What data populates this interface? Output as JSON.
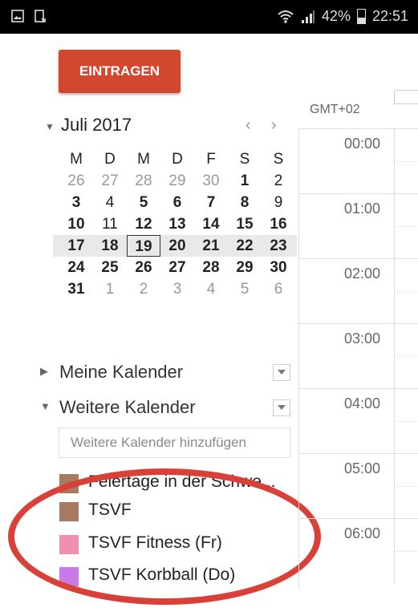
{
  "status_bar": {
    "battery": "42%",
    "battery_level": 0.42,
    "time": "22:51"
  },
  "create_button": "EINTRAGEN",
  "timezone": "GMT+02",
  "mini_calendar": {
    "title": "Juli 2017",
    "prev": "‹",
    "next": "›",
    "weekdays": [
      "M",
      "D",
      "M",
      "D",
      "F",
      "S",
      "S"
    ],
    "weeks": [
      [
        {
          "d": "26",
          "o": true
        },
        {
          "d": "27",
          "o": true
        },
        {
          "d": "28",
          "o": true
        },
        {
          "d": "29",
          "o": true
        },
        {
          "d": "30",
          "o": true
        },
        {
          "d": "1",
          "b": true
        },
        {
          "d": "2"
        }
      ],
      [
        {
          "d": "3",
          "b": true
        },
        {
          "d": "4"
        },
        {
          "d": "5",
          "b": true
        },
        {
          "d": "6",
          "b": true
        },
        {
          "d": "7",
          "b": true
        },
        {
          "d": "8",
          "b": true
        },
        {
          "d": "9"
        }
      ],
      [
        {
          "d": "10",
          "b": true
        },
        {
          "d": "11"
        },
        {
          "d": "12",
          "b": true
        },
        {
          "d": "13",
          "b": true
        },
        {
          "d": "14",
          "b": true
        },
        {
          "d": "15",
          "b": true
        },
        {
          "d": "16",
          "b": true
        }
      ],
      [
        {
          "d": "17",
          "b": true
        },
        {
          "d": "18",
          "b": true
        },
        {
          "d": "19",
          "b": true,
          "t": true
        },
        {
          "d": "20",
          "b": true
        },
        {
          "d": "21",
          "b": true
        },
        {
          "d": "22",
          "b": true
        },
        {
          "d": "23",
          "b": true
        }
      ],
      [
        {
          "d": "24",
          "b": true
        },
        {
          "d": "25",
          "b": true
        },
        {
          "d": "26",
          "b": true
        },
        {
          "d": "27",
          "b": true
        },
        {
          "d": "28",
          "b": true
        },
        {
          "d": "29",
          "b": true
        },
        {
          "d": "30",
          "b": true
        }
      ],
      [
        {
          "d": "31",
          "b": true
        },
        {
          "d": "1",
          "o": true
        },
        {
          "d": "2",
          "o": true
        },
        {
          "d": "3",
          "o": true
        },
        {
          "d": "4",
          "o": true
        },
        {
          "d": "5",
          "o": true
        },
        {
          "d": "6",
          "o": true
        }
      ]
    ]
  },
  "my_calendars": {
    "label": "Meine Kalender"
  },
  "other_calendars": {
    "label": "Weitere Kalender",
    "add_placeholder": "Weitere Kalender hinzufügen",
    "items": [
      {
        "name": "Feiertage in der Schwe...",
        "color": "#a97a62"
      },
      {
        "name": "TSVF",
        "color": "#a97a62"
      },
      {
        "name": "TSVF Fitness (Fr)",
        "color": "#f090b0"
      },
      {
        "name": "TSVF Korbball (Do)",
        "color": "#c87ae8"
      }
    ]
  },
  "hours": [
    "00:00",
    "01:00",
    "02:00",
    "03:00",
    "04:00",
    "05:00",
    "06:00"
  ],
  "annotation_color": "#d84038"
}
